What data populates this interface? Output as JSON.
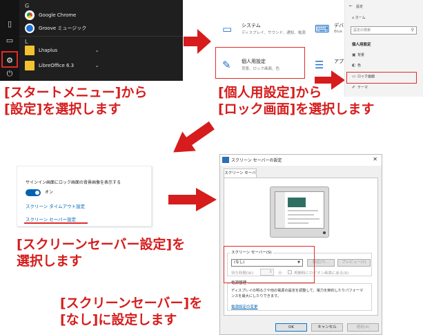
{
  "colors": {
    "accent_red": "#e02a2a",
    "windows_blue": "#0063b1",
    "start_bg": "#1f1f1f"
  },
  "start_menu": {
    "letter_g": "G",
    "letter_l": "L",
    "apps": [
      {
        "name": "Google Chrome",
        "icon": "chrome-icon"
      },
      {
        "name": "Groove ミュージック",
        "icon": "groove-music-icon"
      },
      {
        "name": "Lhaplus",
        "icon": "folder-icon"
      },
      {
        "name": "LibreOffice 6.3",
        "icon": "folder-icon"
      }
    ],
    "rail_icons": [
      "document-icon",
      "picture-icon",
      "gear-icon",
      "power-icon"
    ]
  },
  "settings_grid": {
    "tiles": [
      {
        "title": "システム",
        "sub": "ディスプレイ、サウンド、通知、電源",
        "icon": "laptop-icon"
      },
      {
        "title": "デバ",
        "sub": "Blue",
        "icon": "devices-icon"
      },
      {
        "title": "個人用設定",
        "sub": "背景、ロック画面、色",
        "icon": "personalization-icon"
      },
      {
        "title": "アプ",
        "sub": "",
        "icon": "apps-icon"
      }
    ]
  },
  "personalization": {
    "title": "設定",
    "home": "ホーム",
    "search_placeholder": "設定の検索",
    "header": "個人用設定",
    "items": [
      {
        "label": "背景",
        "icon": "picture-icon"
      },
      {
        "label": "色",
        "icon": "palette-icon"
      },
      {
        "label": "ロック画面",
        "icon": "lock-screen-icon"
      },
      {
        "label": "テーマ",
        "icon": "theme-icon"
      }
    ]
  },
  "lock_screen": {
    "question": "サインイン画面にロック画面の背景画像を表示する",
    "toggle_state": "オン",
    "toggle_on": true,
    "link_timeout": "スクリーン タイムアウト設定",
    "link_screensaver": "スクリーン セーバー設定"
  },
  "dialog": {
    "title": "スクリーン セーバーの設定",
    "close": "✕",
    "tab": "スクリーン セーバー",
    "group_label": "スクリーン セーバー(S)",
    "selected": "(なし)",
    "btn_settings": "設定(T)...",
    "btn_preview": "プレビュー(V)",
    "wait_label": "待ち時間(W):",
    "wait_value": "5",
    "wait_unit": "分",
    "resume_label": "再開時にログオン画面に戻る(R)",
    "power_label": "電源管理",
    "power_desc": "ディスプレイの明るさや他の電源の設定を調整して、電力を節約したりパフォーマンスを最大にしたりできます。",
    "power_link": "電源設定の変更",
    "btn_ok": "OK",
    "btn_cancel": "キャンセル",
    "btn_apply": "適用(A)"
  },
  "captions": {
    "c1_line1": "[スタートメニュー]から",
    "c1_line2": "[設定]を選択します",
    "c2_line1": "[個人用設定]から",
    "c2_line2": "[ロック画面]を選択します",
    "c3_line1": "[スクリーンセーバー設定]を",
    "c3_line2": "選択します",
    "c4_line1": "[スクリーンセーバー]を",
    "c4_line2": "[なし]に設定します"
  }
}
